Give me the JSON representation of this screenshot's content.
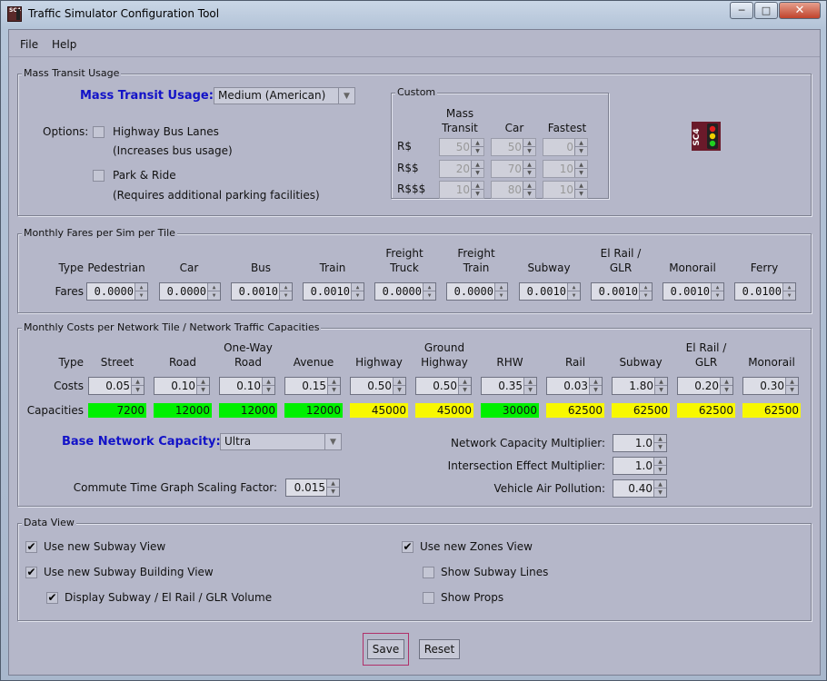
{
  "window": {
    "title": "Traffic Simulator Configuration Tool",
    "icon": "sc4-traffic-icon",
    "controls": {
      "minimize": "─",
      "maximize": "□",
      "close": "✕"
    }
  },
  "menu": [
    "File",
    "Help"
  ],
  "mass_transit": {
    "group_title": "Mass Transit Usage",
    "heading": "Mass Transit Usage:",
    "selected": "Medium (American)",
    "options_label": "Options:",
    "highway_bus_lanes": {
      "label": "Highway Bus Lanes",
      "note": "(Increases bus usage)",
      "checked": false
    },
    "park_ride": {
      "label": "Park & Ride",
      "note": "(Requires additional parking facilities)",
      "checked": false
    },
    "custom": {
      "title": "Custom",
      "col_headers": [
        "Mass\nTransit",
        "Car",
        "Fastest"
      ],
      "col_header_lines": [
        [
          "Mass",
          "Transit"
        ],
        [
          "Car"
        ],
        [
          "Fastest"
        ]
      ],
      "rows": [
        {
          "label": "R$",
          "values": [
            "50",
            "50",
            "0"
          ]
        },
        {
          "label": "R$$",
          "values": [
            "20",
            "70",
            "10"
          ]
        },
        {
          "label": "R$$$",
          "values": [
            "10",
            "80",
            "10"
          ]
        }
      ]
    },
    "logo_text": "SC4"
  },
  "fares": {
    "group_title": "Monthly Fares per Sim per Tile",
    "type_label": "Type",
    "fares_label": "Fares",
    "columns": [
      {
        "name": [
          "Pedestrian"
        ],
        "value": "0.0000"
      },
      {
        "name": [
          "Car"
        ],
        "value": "0.0000"
      },
      {
        "name": [
          "Bus"
        ],
        "value": "0.0010"
      },
      {
        "name": [
          "Train"
        ],
        "value": "0.0010"
      },
      {
        "name": [
          "Freight",
          "Truck"
        ],
        "value": "0.0000"
      },
      {
        "name": [
          "Freight",
          "Train"
        ],
        "value": "0.0000"
      },
      {
        "name": [
          "Subway"
        ],
        "value": "0.0010"
      },
      {
        "name": [
          "El Rail /",
          "GLR"
        ],
        "value": "0.0010"
      },
      {
        "name": [
          "Monorail"
        ],
        "value": "0.0010"
      },
      {
        "name": [
          "Ferry"
        ],
        "value": "0.0100"
      }
    ]
  },
  "costs": {
    "group_title": "Monthly Costs per Network Tile / Network Traffic Capacities",
    "type_label": "Type",
    "costs_label": "Costs",
    "capacities_label": "Capacities",
    "columns": [
      {
        "name": [
          "Street"
        ],
        "cost": "0.05",
        "capacity": "7200",
        "color": "#00f000"
      },
      {
        "name": [
          "Road"
        ],
        "cost": "0.10",
        "capacity": "12000",
        "color": "#00f000"
      },
      {
        "name": [
          "One-Way",
          "Road"
        ],
        "cost": "0.10",
        "capacity": "12000",
        "color": "#00f000"
      },
      {
        "name": [
          "Avenue"
        ],
        "cost": "0.15",
        "capacity": "12000",
        "color": "#00f000"
      },
      {
        "name": [
          "Highway"
        ],
        "cost": "0.50",
        "capacity": "45000",
        "color": "#f8f800"
      },
      {
        "name": [
          "Ground",
          "Highway"
        ],
        "cost": "0.50",
        "capacity": "45000",
        "color": "#f8f800"
      },
      {
        "name": [
          "RHW"
        ],
        "cost": "0.35",
        "capacity": "30000",
        "color": "#00f000"
      },
      {
        "name": [
          "Rail"
        ],
        "cost": "0.03",
        "capacity": "62500",
        "color": "#f8f800"
      },
      {
        "name": [
          "Subway"
        ],
        "cost": "1.80",
        "capacity": "62500",
        "color": "#f8f800"
      },
      {
        "name": [
          "El Rail /",
          "GLR"
        ],
        "cost": "0.20",
        "capacity": "62500",
        "color": "#f8f800"
      },
      {
        "name": [
          "Monorail"
        ],
        "cost": "0.30",
        "capacity": "62500",
        "color": "#f8f800"
      }
    ],
    "base_capacity_label": "Base Network Capacity:",
    "base_capacity_value": "Ultra",
    "commute_label": "Commute Time Graph Scaling Factor:",
    "commute_value": "0.015",
    "network_multiplier_label": "Network Capacity Multiplier:",
    "network_multiplier_value": "1.0",
    "intersection_label": "Intersection Effect Multiplier:",
    "intersection_value": "1.0",
    "pollution_label": "Vehicle Air Pollution:",
    "pollution_value": "0.40"
  },
  "data_view": {
    "group_title": "Data View",
    "items": [
      {
        "label": "Use new Subway View",
        "checked": true
      },
      {
        "label": "Use new Subway Building View",
        "checked": true
      },
      {
        "label": "Display Subway / El Rail / GLR Volume",
        "checked": true
      },
      {
        "label": "Use new Zones View",
        "checked": true
      },
      {
        "label": "Show Subway Lines",
        "checked": false
      },
      {
        "label": "Show Props",
        "checked": false
      }
    ]
  },
  "buttons": {
    "save": "Save",
    "reset": "Reset"
  },
  "check_glyph": "✔"
}
